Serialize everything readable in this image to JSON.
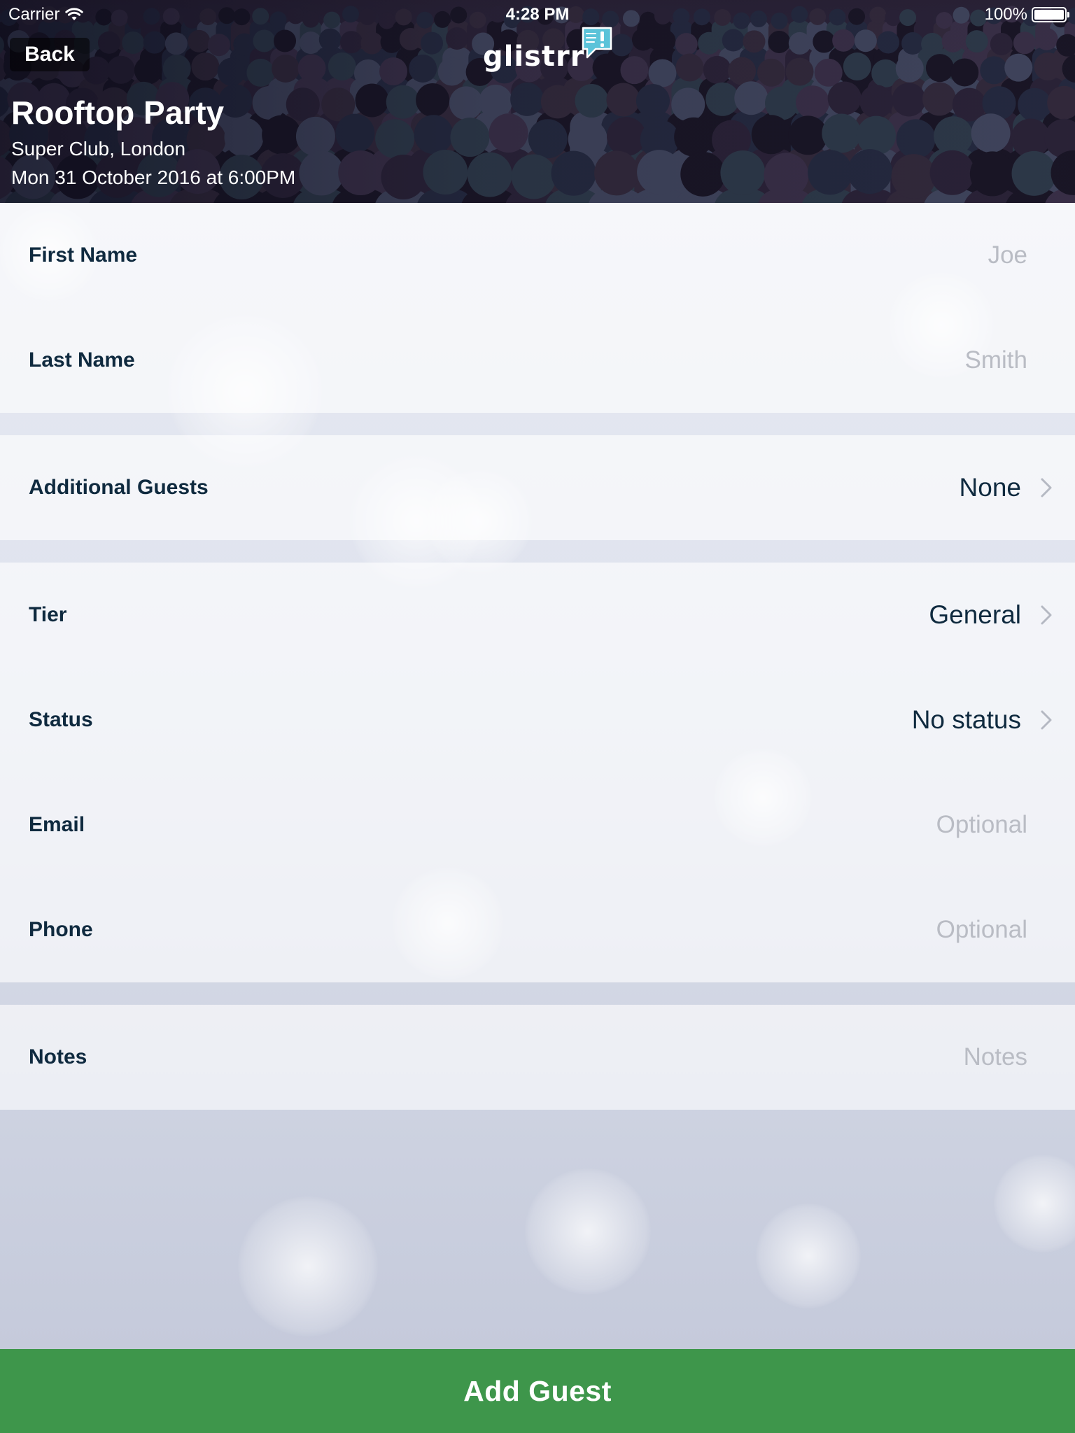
{
  "status_bar": {
    "carrier": "Carrier",
    "time": "4:28 PM",
    "battery": "100%"
  },
  "nav": {
    "back_label": "Back",
    "logo_text": "glistrr"
  },
  "event": {
    "title": "Rooftop Party",
    "venue": "Super Club, London",
    "date": "Mon 31 October 2016 at 6:00PM"
  },
  "form": {
    "first_name": {
      "label": "First Name",
      "placeholder": "Joe"
    },
    "last_name": {
      "label": "Last Name",
      "placeholder": "Smith"
    },
    "additional_guests": {
      "label": "Additional Guests",
      "value": "None"
    },
    "tier": {
      "label": "Tier",
      "value": "General"
    },
    "status": {
      "label": "Status",
      "value": "No status"
    },
    "email": {
      "label": "Email",
      "placeholder": "Optional"
    },
    "phone": {
      "label": "Phone",
      "placeholder": "Optional"
    },
    "notes": {
      "label": "Notes",
      "placeholder": "Notes"
    }
  },
  "actions": {
    "add_guest_label": "Add Guest"
  },
  "colors": {
    "accent_green": "#3e964b",
    "label_navy": "#0f2a3f",
    "placeholder_gray": "#b9bcc4"
  }
}
